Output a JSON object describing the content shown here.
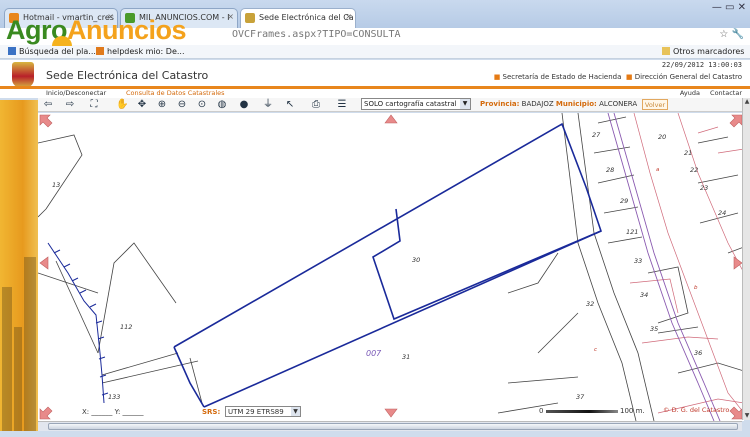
{
  "browser": {
    "tabs": [
      {
        "label": "Hotmail - vmartin_cres",
        "icon_color": "#e8861c",
        "active": false
      },
      {
        "label": "MIL ANUNCIOS.COM - I",
        "icon_color": "#4a9a2a",
        "active": false
      },
      {
        "label": "Sede Electrónica del Ca",
        "icon_color": "#c8a23a",
        "active": true
      }
    ],
    "tab_close_glyph": "×",
    "address": "OVCFrames.aspx?TIPO=CONSULTA",
    "nav_icons": "☆ 🔧",
    "window_buttons": "— ▭ ✕"
  },
  "bookmarks": [
    {
      "label": "Búsqueda del pla...",
      "icon_color": "#3b72c4"
    },
    {
      "label": "helpdesk mio: De...",
      "icon_color": "#e07a1c"
    }
  ],
  "bookmarks_other": "Otros marcadores",
  "watermark": {
    "part1": "Agro",
    "part2": "Anuncios"
  },
  "site": {
    "title": "Sede Electrónica del Catastro",
    "datetime": "22/09/2012 13:00:03",
    "links": [
      "Secretaría de Estado de Hacienda",
      "Dirección General del Catastro"
    ],
    "link_bullet": "■",
    "subnav_left": [
      "Inicio/Desconectar",
      "Consulta de Datos Catastrales"
    ],
    "subnav_right": [
      "Ayuda",
      "Contactar"
    ]
  },
  "toolbar": {
    "cartography_select": "SOLO cartografía catastral",
    "provincia_label": "Provincia:",
    "provincia_value": "BADAJOZ",
    "municipio_label": "Municipio:",
    "municipio_value": "ALCONERA",
    "volver_label": "Volver"
  },
  "map": {
    "parcel_labels": [
      "13",
      "112",
      "133",
      "30",
      "31",
      "32",
      "37",
      "27",
      "28",
      "29",
      "121",
      "33",
      "34",
      "35",
      "36",
      "20",
      "21",
      "22",
      "23",
      "24"
    ],
    "zone_label": "007",
    "small_labels": [
      "a",
      "b",
      "c"
    ]
  },
  "coords": {
    "x_label": "X:",
    "y_label": "Y:",
    "srs_label": "SRS:",
    "srs_value": "UTM 29 ETRS89",
    "scale_zero": "0",
    "scale_unit": "100 m.",
    "copyright": "© D. G. del Catastro"
  },
  "colors": {
    "accent": "#e8861c",
    "parcel_outline": "#1a2a9a",
    "brand_green": "#3a8a20",
    "brand_orange": "#f4a21c"
  }
}
